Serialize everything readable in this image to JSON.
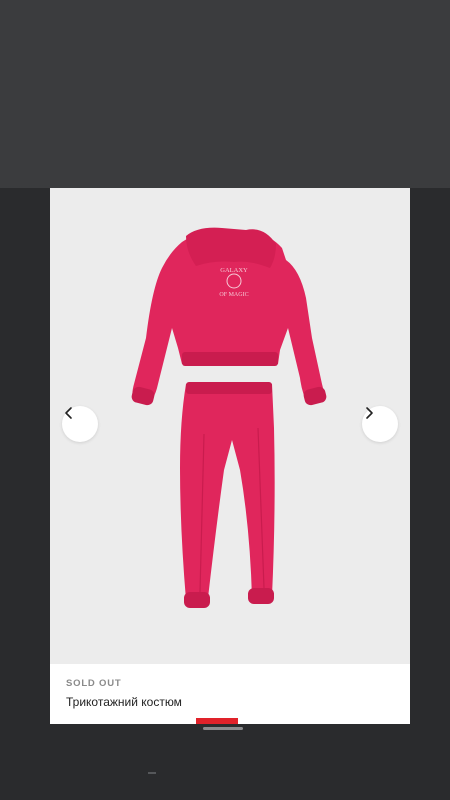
{
  "product": {
    "status": "SOLD OUT",
    "title": "Трикотажний костюм",
    "image": {
      "description": "pink hoodie and jogger set",
      "print_line1": "GALAXY",
      "print_line2": "OF MAGIC",
      "color": "#e0265c"
    }
  },
  "gallery": {
    "prev_icon": "chevron-left-icon",
    "next_icon": "chevron-right-icon",
    "indicator_color": "#e0222a"
  }
}
